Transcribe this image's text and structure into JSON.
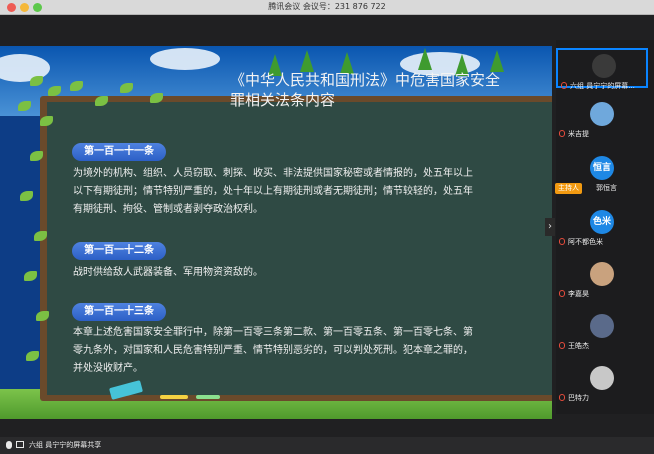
{
  "window": {
    "title": "腾讯会议 会议号：231 876 722"
  },
  "slide": {
    "heading_line1": "《中华人民共和国刑法》中危害国家安全",
    "heading_line2": "罪相关法条内容",
    "sections": [
      {
        "badge": "第一百一十一条",
        "lines": [
          "为境外的机构、组织、人员窃取、刺探、收买、非法提供国家秘密或者情报的，处五年以上",
          "以下有期徒刑；情节特别严重的，处十年以上有期徒刑或者无期徒刑；情节较轻的，处五年",
          "有期徒刑、拘役、管制或者剥夺政治权利。"
        ]
      },
      {
        "badge": "第一百一十二条",
        "lines": [
          "战时供给敌人武器装备、军用物资资敌的。"
        ]
      },
      {
        "badge": "第一百一十三条",
        "lines": [
          "本章上述危害国家安全罪行中，除第一百零三条第二款、第一百零五条、第一百零七条、第",
          "零九条外，对国家和人民危害特别严重、情节特别恶劣的，可以判处死刑。犯本章之罪的，",
          "并处没收财产。"
        ]
      }
    ]
  },
  "participants": [
    {
      "label": "六组 員宁宁的屏幕...",
      "avatar_text": "",
      "avatar_color": "#3a3a3a",
      "icon": "video-photo"
    },
    {
      "label": "米吉提",
      "avatar_text": "",
      "avatar_color": "#6fa8dc",
      "icon": "landscape-photo"
    },
    {
      "label": "郭恒言",
      "avatar_text": "恒言",
      "avatar_color": "#1e88e5",
      "icon": ""
    },
    {
      "label": "阿不都色米",
      "avatar_text": "色米",
      "avatar_color": "#1e88e5",
      "icon": ""
    },
    {
      "label": "李嘉昊",
      "avatar_text": "",
      "avatar_color": "#c9a27e",
      "icon": "cartoon-photo"
    },
    {
      "label": "王皓杰",
      "avatar_text": "",
      "avatar_color": "#5a6a8a",
      "icon": "planet-photo"
    },
    {
      "label": "巴特力",
      "avatar_text": "",
      "avatar_color": "#c8c8c8",
      "icon": "portrait-photo"
    }
  ],
  "host_badge": "主持人",
  "bottom": {
    "share_label": "六组 員宁宁的屏幕共享"
  },
  "colors": {
    "badge_blue": "#3f73d6",
    "board": "#2f4a44",
    "host_orange": "#f29a11"
  }
}
